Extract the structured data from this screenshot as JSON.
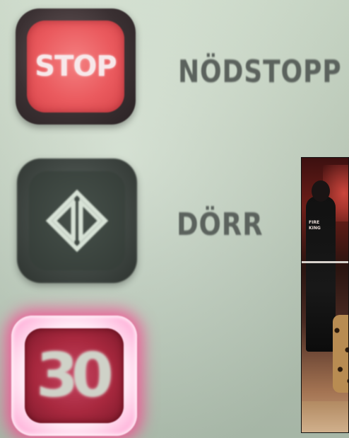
{
  "buttons": {
    "stop": {
      "label": "STOP",
      "icon": "stop-button-icon"
    },
    "door": {
      "icon": "door-open-close-icon"
    },
    "floor": {
      "label": "30"
    }
  },
  "labels": {
    "stop": "NÖDSTOPP",
    "door": "DÖRR"
  },
  "photo": {
    "shirt_text": "FIRE\nKING"
  },
  "colors": {
    "panel": "#c9d8c6",
    "stop_red": "#ea5a5e",
    "floor_glow": "#ff3c8c",
    "label_gray": "#5b625d"
  }
}
